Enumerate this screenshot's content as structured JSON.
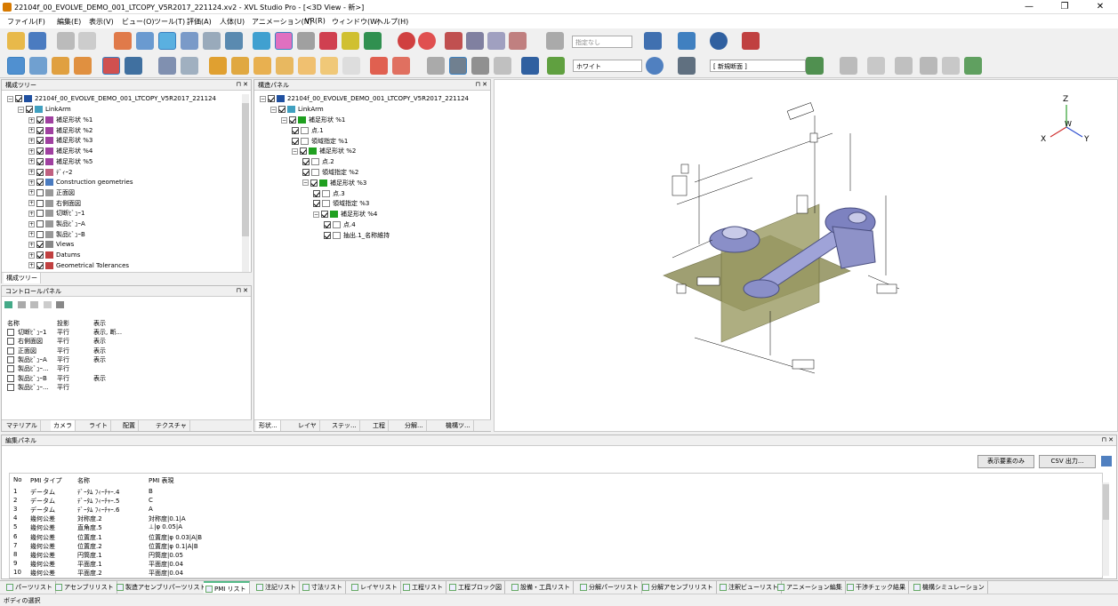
{
  "window": {
    "title": "22104f_00_EVOLVE_DEMO_001_LTCOPY_V5R2017_221124.xv2 - XVL Studio Pro - [<3D View - 新>]",
    "controls": [
      "—",
      "❐",
      "✕"
    ]
  },
  "menu": [
    "ファイル(F)",
    "編集(E)",
    "表示(V)",
    "ビュー(O)",
    "ツール(T)",
    "評価(A)",
    "人体(U)",
    "アニメーション(N)",
    "VR(R)",
    "ウィンドウ(W)",
    "ヘルプ(H)"
  ],
  "toolbar": {
    "designation_dropdown": "指定なし",
    "color_dropdown": "ホワイト",
    "section_dropdown": "[ 新規断面 ]"
  },
  "config_tree": {
    "header": "構成ツリー",
    "root": "22104f_00_EVOLVE_DEMO_001_LTCOPY_V5R2017_221124",
    "link": "LinkArm",
    "items": [
      "補足形状 %1",
      "補足形状 %2",
      "補足形状 %3",
      "補足形状 %4",
      "補足形状 %5",
      "ﾃﾞｨｰ2",
      "Construction geometries",
      "正面図",
      "右側面図",
      "切断ﾋﾞｭｰ1",
      "製品ﾋﾞｭｰA",
      "製品ﾋﾞｭｰB",
      "Views",
      "Datums",
      "Geometrical Tolerances"
    ],
    "tab": "構成ツリー"
  },
  "struct_panel": {
    "header": "構造パネル",
    "root": "22104f_00_EVOLVE_DEMO_001_LTCOPY_V5R2017_221124",
    "link": "LinkArm",
    "items": [
      {
        "label": "補足形状 %1",
        "level": 2
      },
      {
        "label": "点.1",
        "level": 3
      },
      {
        "label": "領域指定 %1",
        "level": 3
      },
      {
        "label": "補足形状 %2",
        "level": 3
      },
      {
        "label": "点.2",
        "level": 4
      },
      {
        "label": "領域指定 %2",
        "level": 4
      },
      {
        "label": "補足形状 %3",
        "level": 4
      },
      {
        "label": "点.3",
        "level": 5
      },
      {
        "label": "領域指定 %3",
        "level": 5
      },
      {
        "label": "補足形状 %4",
        "level": 5
      },
      {
        "label": "点.4",
        "level": 6
      },
      {
        "label": "抽出.1_名称維持",
        "level": 6
      }
    ],
    "tabs": [
      "形状...",
      "レイヤ",
      "ステッ...",
      "工程",
      "分解...",
      "機構ツ..."
    ]
  },
  "control_panel": {
    "header": "コントロールパネル",
    "columns": [
      "名称",
      "投影",
      "表示"
    ],
    "rows": [
      [
        "切断ﾋﾞｭｰ1",
        "平行",
        "表示, 断..."
      ],
      [
        "右側面図",
        "平行",
        "表示"
      ],
      [
        "正面図",
        "平行",
        "表示"
      ],
      [
        "製品ﾋﾞｭｰA",
        "平行",
        "表示"
      ],
      [
        "製品ﾋﾞｭｰ...",
        "平行",
        ""
      ],
      [
        "製品ﾋﾞｭｰB",
        "平行",
        "表示"
      ],
      [
        "製品ﾋﾞｭｰ...",
        "平行",
        ""
      ]
    ],
    "tabs": [
      "マテリアル",
      "カメラ",
      "ライト",
      "配置",
      "テクスチャ"
    ]
  },
  "triad": {
    "z": "Z",
    "x": "X",
    "y": "Y",
    "w": "W"
  },
  "edit_panel": {
    "header": "編集パネル",
    "btn_show": "表示要素のみ",
    "btn_csv": "CSV 出力...",
    "columns": [
      "No",
      "PMI タイプ",
      "名称",
      "PMI 表現"
    ],
    "rows": [
      [
        "1",
        "データム",
        "ﾃﾞｰﾀﾑ ﾌｨｰﾁｬｰ.4",
        "B"
      ],
      [
        "2",
        "データム",
        "ﾃﾞｰﾀﾑ ﾌｨｰﾁｬｰ.5",
        "C"
      ],
      [
        "3",
        "データム",
        "ﾃﾞｰﾀﾑ ﾌｨｰﾁｬｰ.6",
        "A"
      ],
      [
        "4",
        "幾何公差",
        "対称度.2",
        "対称度|0.1|A"
      ],
      [
        "5",
        "幾何公差",
        "直角度.5",
        "⊥|φ 0.05|A"
      ],
      [
        "6",
        "幾何公差",
        "位置度.1",
        "位置度|φ 0.03|A|B"
      ],
      [
        "7",
        "幾何公差",
        "位置度.2",
        "位置度|φ 0.1|A|B"
      ],
      [
        "8",
        "幾何公差",
        "円筒度.1",
        "円筒度|0.05"
      ],
      [
        "9",
        "幾何公差",
        "平面度.1",
        "平面度|0.04"
      ],
      [
        "10",
        "幾何公差",
        "平面度.2",
        "平面度|0.04"
      ]
    ]
  },
  "bottom_tabs": [
    "パーツリスト",
    "アセンブリリスト",
    "製造アセンブリパーツリスト",
    "PMI リスト",
    "注記リスト",
    "寸法リスト",
    "レイヤリスト",
    "工程リスト",
    "工程ブロック図",
    "設備・工具リスト",
    "分解パーツリスト",
    "分解アセンブリリスト",
    "注釈ビューリスト",
    "アニメーション編集",
    "干渉チェック結果",
    "機構シミュレーション"
  ],
  "status": "ボディの選択",
  "colors": {
    "accent": "#3aa6e0",
    "model": "#8a8fc8",
    "plane": "#8f8f5a"
  }
}
